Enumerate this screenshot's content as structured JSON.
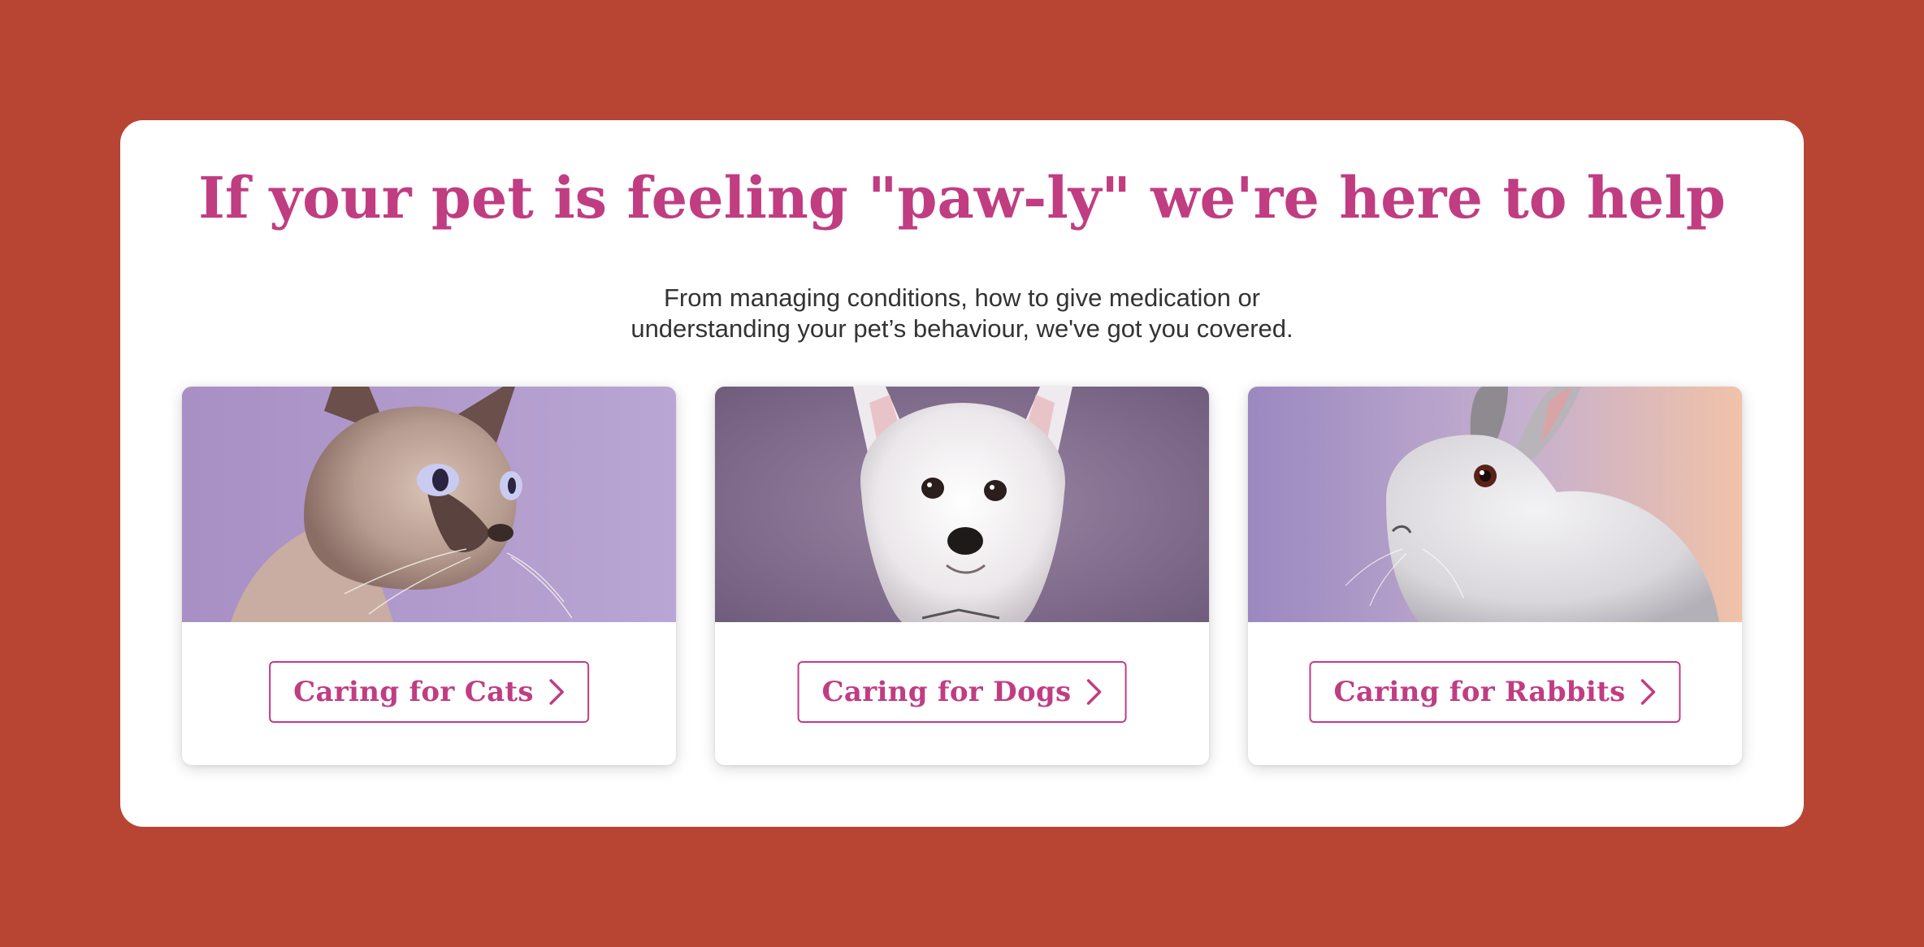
{
  "colors": {
    "page_background": "#b84434",
    "panel_background": "#ffffff",
    "accent": "#c03d82",
    "body_text": "#333333"
  },
  "hero": {
    "headline": "If your pet is feeling \"paw-ly\" we're here to help",
    "subtext_line1": "From managing conditions, how to give medication or",
    "subtext_line2": "understanding your pet’s behaviour, we've got you covered."
  },
  "cards": [
    {
      "image": "siamese-cat-photo",
      "button_label": "Caring for Cats",
      "icon": "chevron-right-icon"
    },
    {
      "image": "west-highland-terrier-photo",
      "button_label": "Caring for Dogs",
      "icon": "chevron-right-icon"
    },
    {
      "image": "white-rabbit-photo",
      "button_label": "Caring for Rabbits",
      "icon": "chevron-right-icon"
    }
  ]
}
